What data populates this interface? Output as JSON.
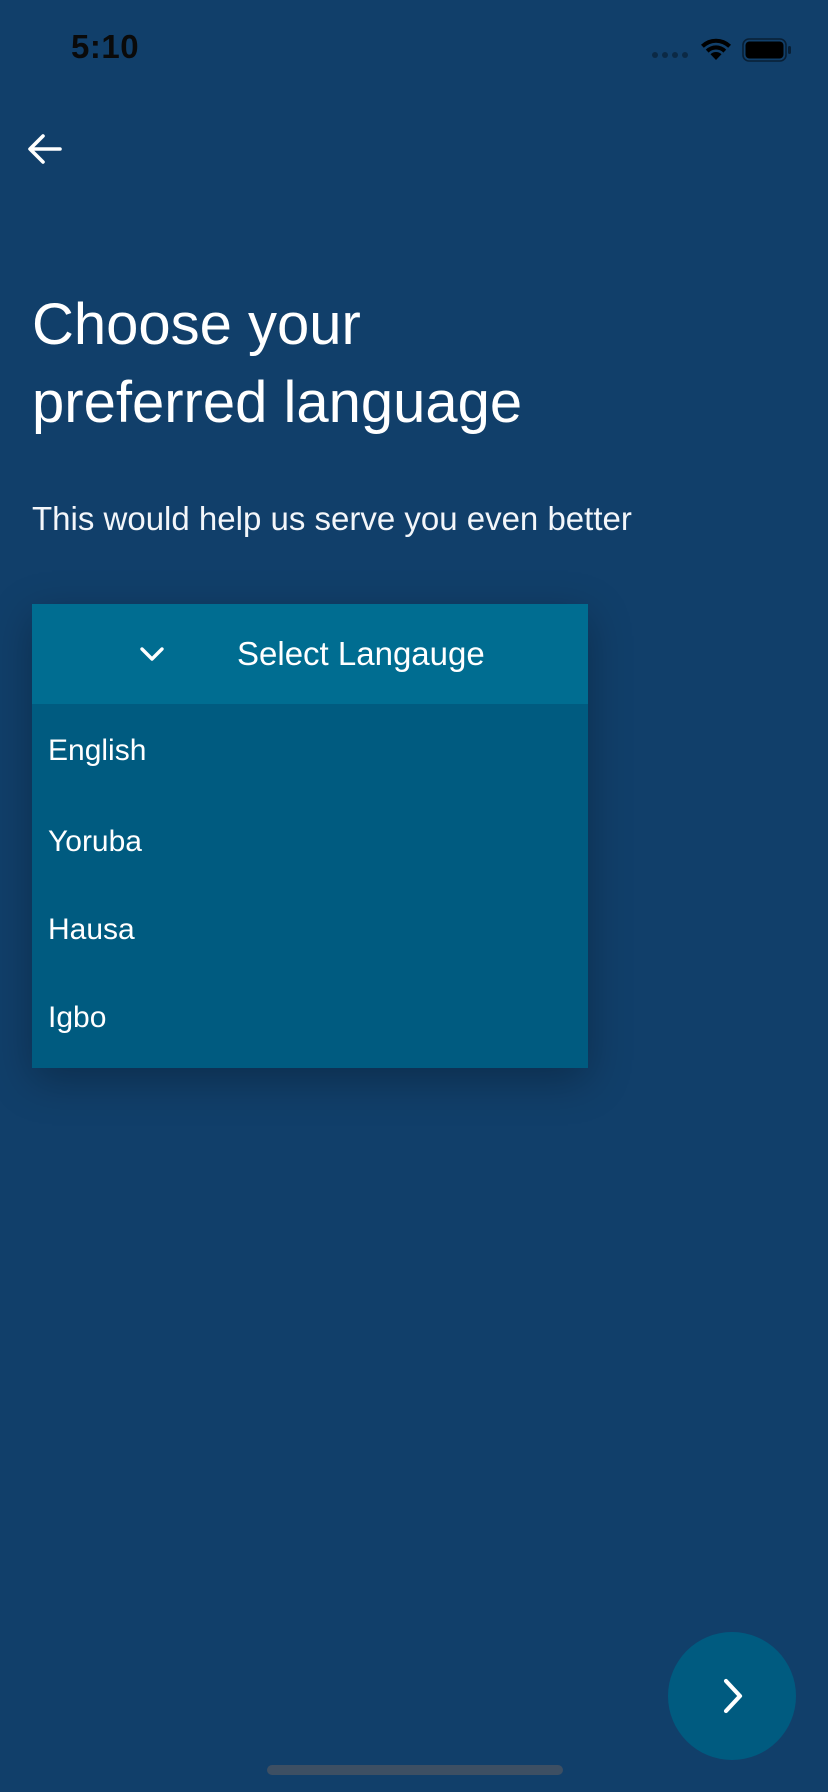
{
  "status_bar": {
    "time": "5:10"
  },
  "header": {
    "back_icon": "arrow-left-icon"
  },
  "main": {
    "title": "Choose your\npreferred language",
    "subtitle": "This would help us serve you even better"
  },
  "language_dropdown": {
    "label": "Select Langauge",
    "expanded": true,
    "chevron_icon": "chevron-down-icon",
    "options": [
      "English",
      "Yoruba",
      "Hausa",
      "Igbo"
    ]
  },
  "footer": {
    "next_icon": "chevron-right-icon"
  },
  "colors": {
    "background": "#113f6a",
    "dropdown_header": "#006d91",
    "dropdown_list": "#005b80",
    "fab": "#005b80"
  }
}
